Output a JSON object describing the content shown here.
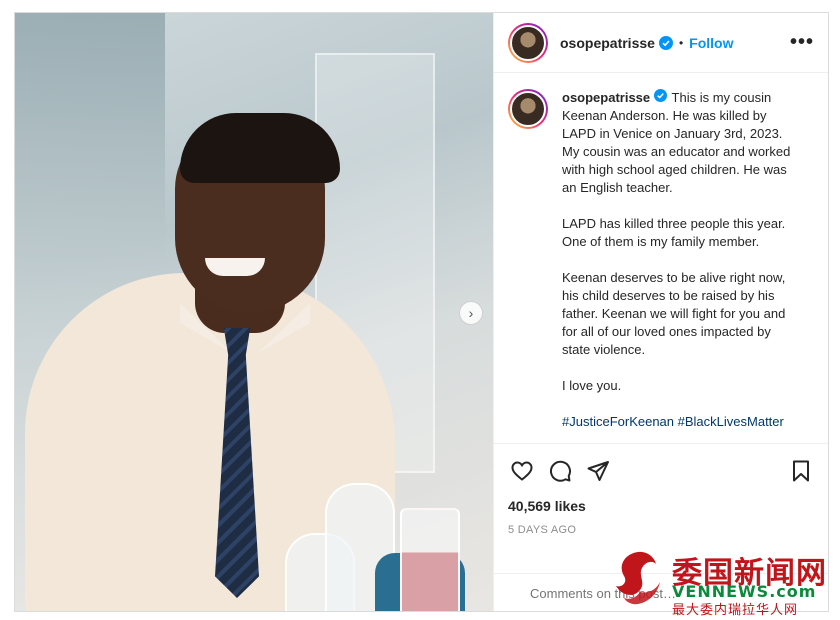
{
  "post": {
    "username": "osopepatrisse",
    "separator": "•",
    "follow_label": "Follow",
    "more_label": "•••",
    "next_label": "›"
  },
  "caption": {
    "username": "osopepatrisse",
    "paragraphs": [
      "This is my cousin Keenan Anderson. He was killed by LAPD in Venice on January 3rd, 2023. My cousin was an educator and worked with high school aged children. He was an English teacher.",
      "LAPD has killed three people this year. One of them is my family member.",
      "Keenan deserves to be alive right now, his child deserves to be raised by his father. Keenan we will fight for you and for all of our loved ones impacted by state violence.",
      "I love you."
    ],
    "hashtags": [
      "#JusticeForKeenan",
      "#BlackLivesMatter"
    ]
  },
  "actions": {
    "icons": [
      "heart-icon",
      "comment-icon",
      "share-icon",
      "bookmark-icon"
    ],
    "likes": "40,569 likes",
    "date": "5 DAYS AGO"
  },
  "comment": {
    "placeholder": "Comments on this post…"
  },
  "watermark": {
    "cn_title": "委国新闻网",
    "en": "VENNEWS.com",
    "cn_sub": "最大委内瑞拉华人网"
  },
  "colors": {
    "follow": "#0095f6",
    "hashtag": "#00376b",
    "verified": "#0095f6",
    "watermark_red": "#c0151b",
    "watermark_green": "#0a8a3a"
  }
}
